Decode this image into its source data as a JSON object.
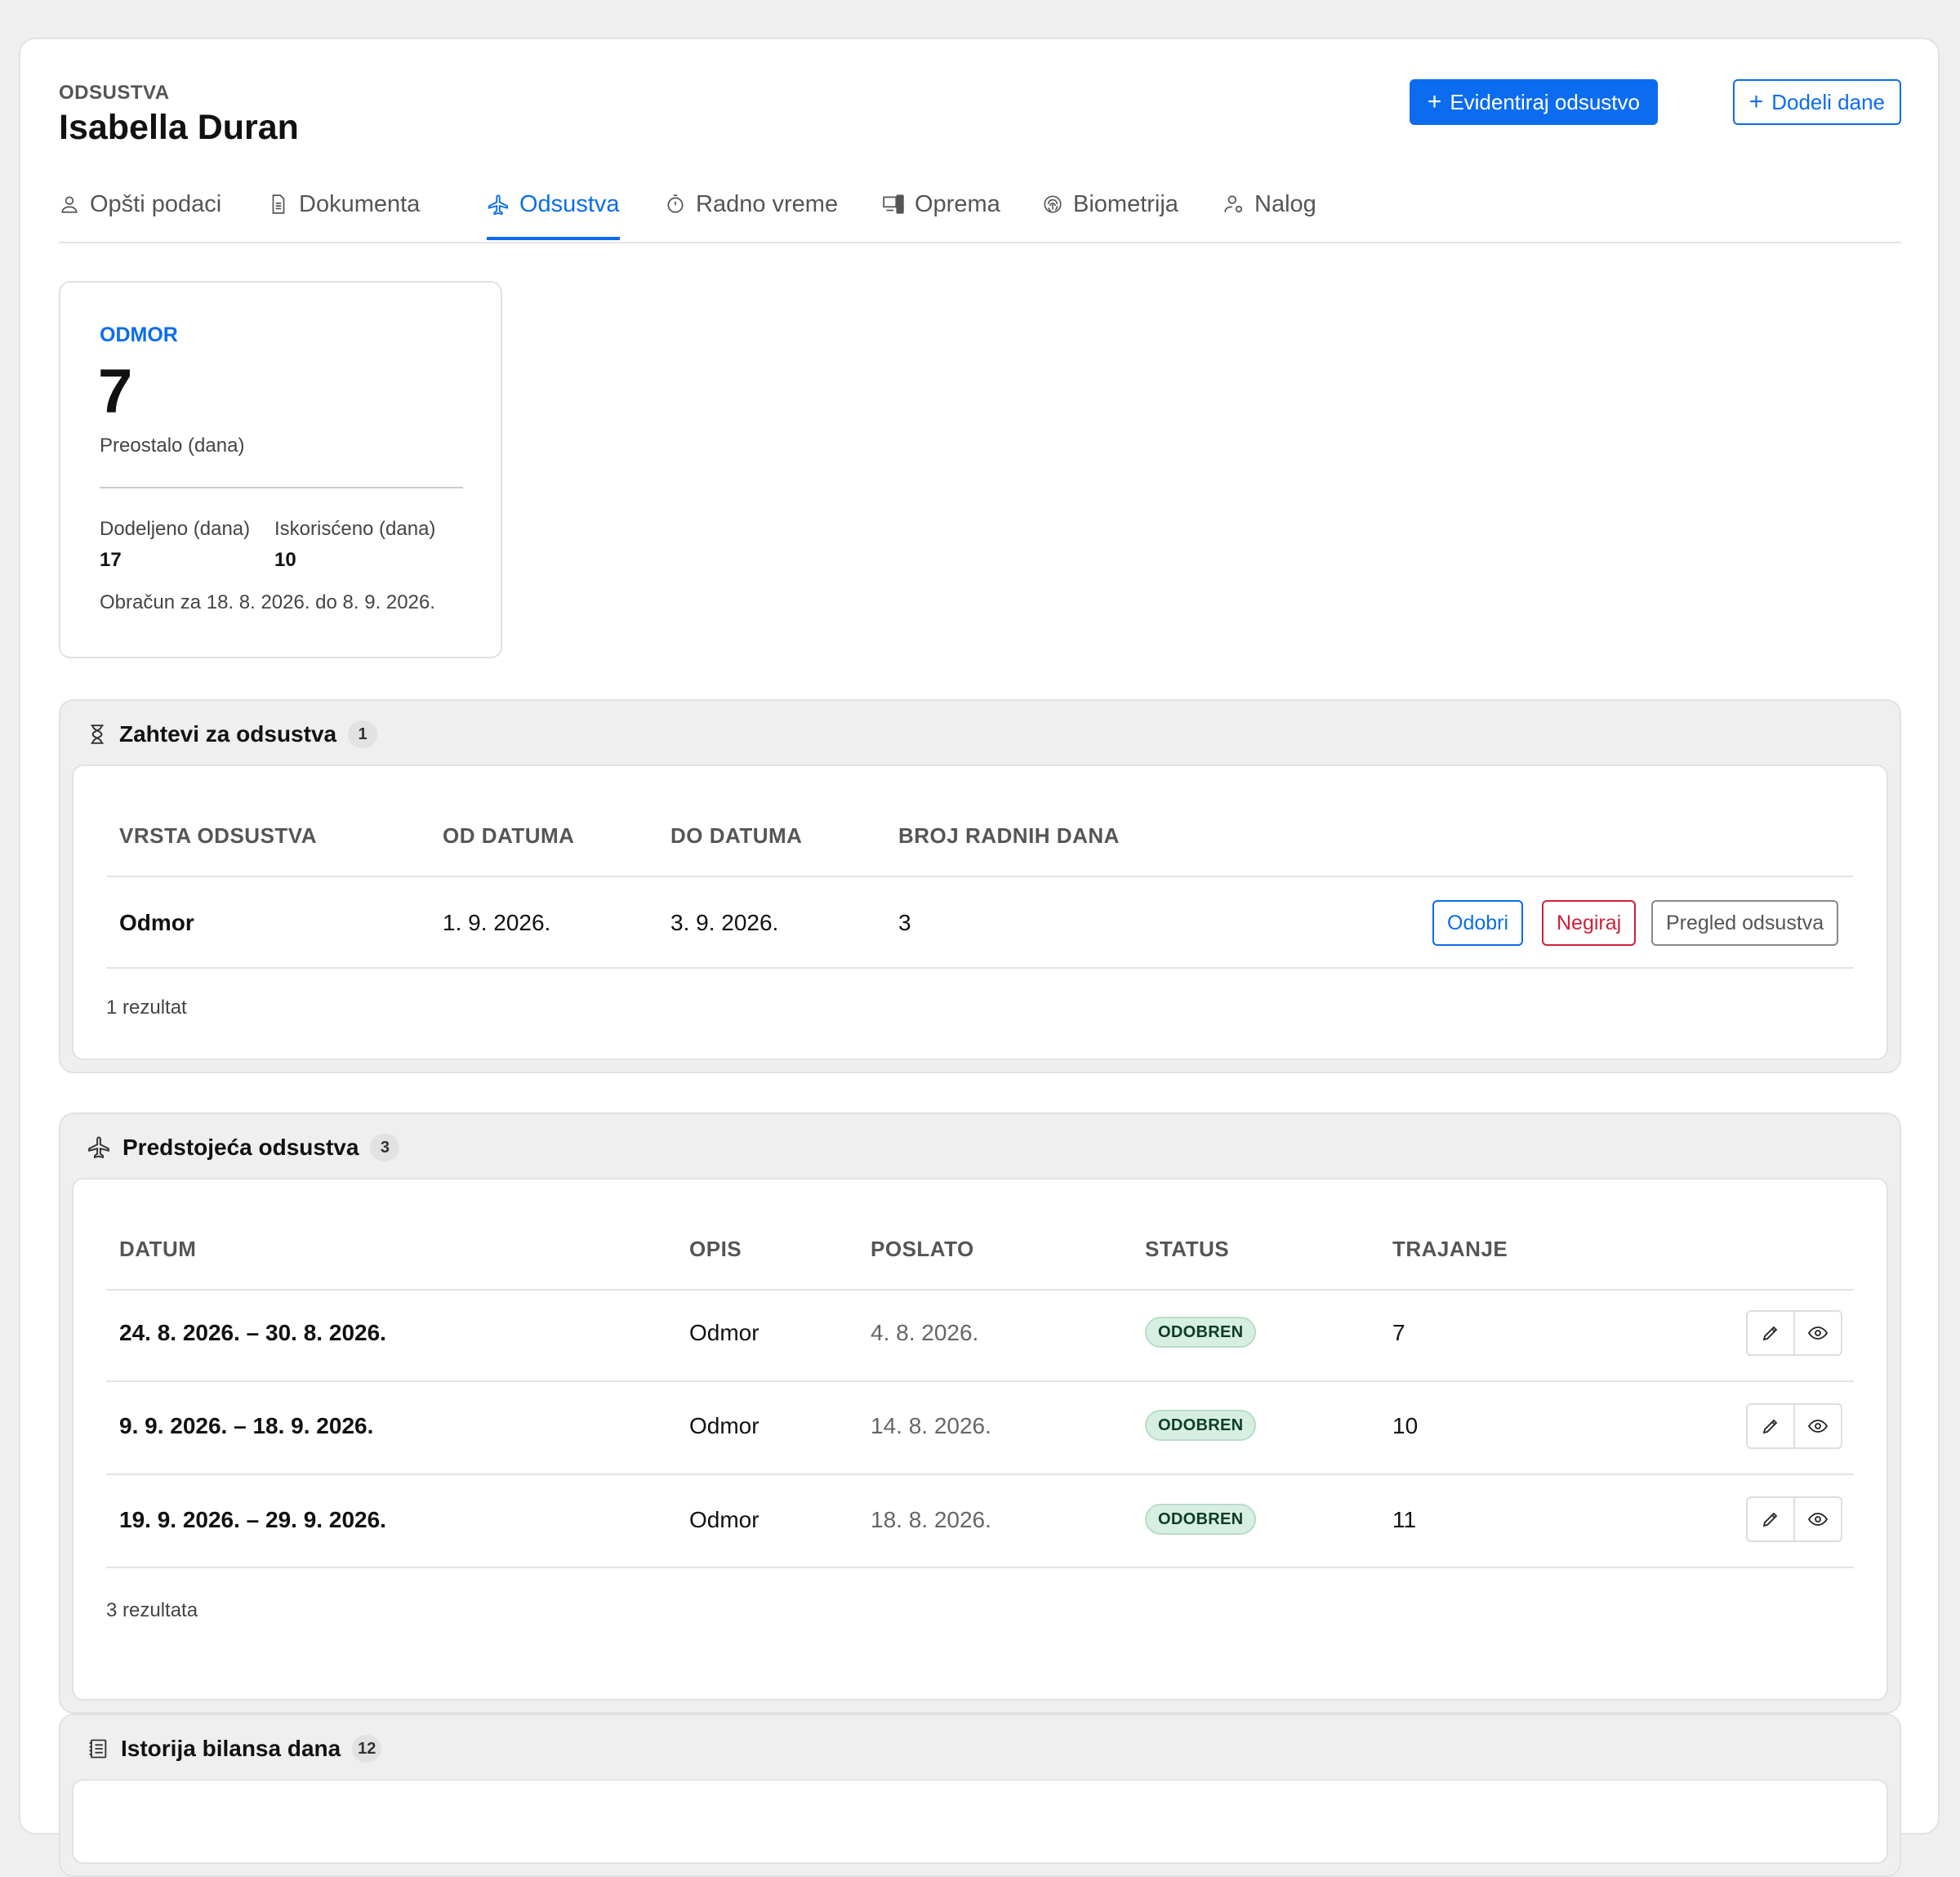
{
  "header": {
    "eyebrow": "ODSUSTVA",
    "name": "Isabella Duran",
    "primary_button": "Evidentiraj odsustvo",
    "secondary_button": "Dodeli dane"
  },
  "tabs": [
    {
      "label": "Opšti podaci",
      "icon": "user-icon",
      "active": false
    },
    {
      "label": "Dokumenta",
      "icon": "document-icon",
      "active": false
    },
    {
      "label": "Odsustva",
      "icon": "airplane-icon",
      "active": true
    },
    {
      "label": "Radno vreme",
      "icon": "stopwatch-icon",
      "active": false
    },
    {
      "label": "Oprema",
      "icon": "devices-icon",
      "active": false
    },
    {
      "label": "Biometrija",
      "icon": "fingerprint-icon",
      "active": false
    },
    {
      "label": "Nalog",
      "icon": "user-settings-icon",
      "active": false
    }
  ],
  "balance": {
    "label": "ODMOR",
    "remaining": "7",
    "remaining_label": "Preostalo (dana)",
    "assigned_label": "Dodeljeno (dana)",
    "assigned": "17",
    "used_label": "Iskorisćeno (dana)",
    "used": "10",
    "period": "Obračun za 18. 8. 2026. do 8. 9. 2026."
  },
  "requests": {
    "title": "Zahtevi za odsustva",
    "count": "1",
    "columns": [
      "VRSTA ODSUSTVA",
      "OD DATUMA",
      "DO DATUMA",
      "BROJ RADNIH DANA"
    ],
    "rows": [
      {
        "type": "Odmor",
        "from": "1. 9. 2026.",
        "to": "3. 9. 2026.",
        "days": "3"
      }
    ],
    "actions": {
      "approve": "Odobri",
      "deny": "Negiraj",
      "view": "Pregled odsustva"
    },
    "footer": "1 rezultat"
  },
  "upcoming": {
    "title": "Predstojeća odsustva",
    "count": "3",
    "columns": [
      "DATUM",
      "OPIS",
      "POSLATO",
      "STATUS",
      "TRAJANJE"
    ],
    "rows": [
      {
        "date": "24. 8. 2026. – 30. 8. 2026.",
        "desc": "Odmor",
        "sent": "4. 8. 2026.",
        "status": "ODOBREN",
        "duration": "7"
      },
      {
        "date": "9. 9. 2026. – 18. 9. 2026.",
        "desc": "Odmor",
        "sent": "14. 8. 2026.",
        "status": "ODOBREN",
        "duration": "10"
      },
      {
        "date": "19. 9. 2026. – 29. 9. 2026.",
        "desc": "Odmor",
        "sent": "18. 8. 2026.",
        "status": "ODOBREN",
        "duration": "11"
      }
    ],
    "footer": "3 rezultata"
  },
  "history": {
    "title": "Istorija bilansa dana",
    "count": "12"
  },
  "colors": {
    "accent": "#0b6cf0",
    "danger": "#d0203a",
    "success_bg": "#d6efe2",
    "page_bg": "#efefef"
  }
}
